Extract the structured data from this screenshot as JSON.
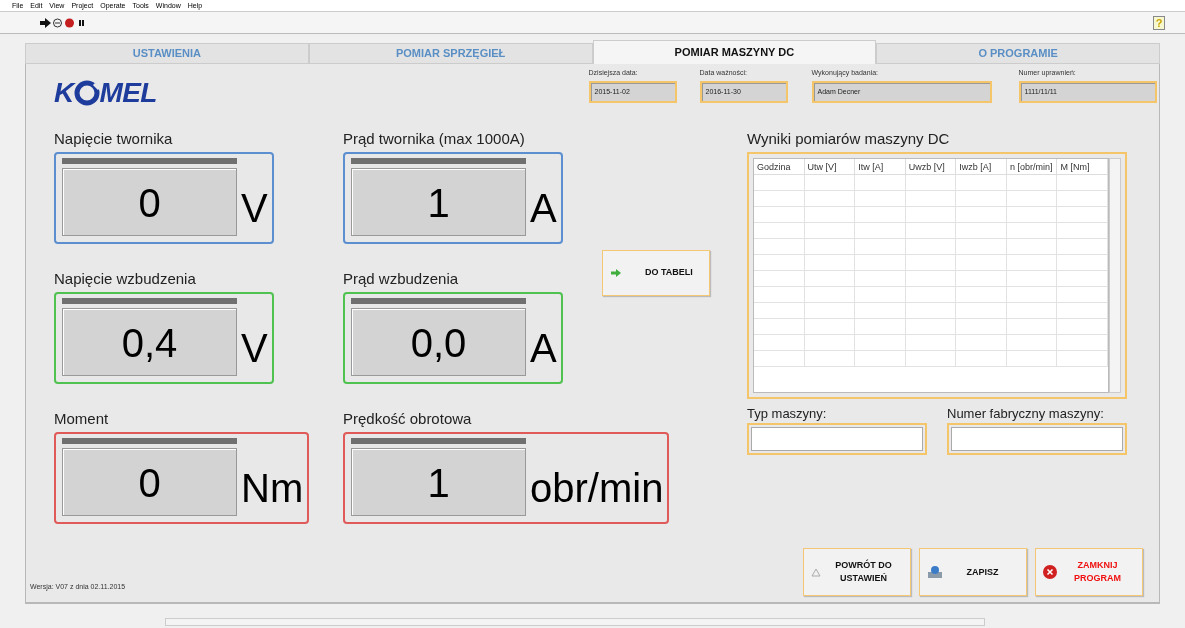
{
  "menu": [
    "File",
    "Edit",
    "View",
    "Project",
    "Operate",
    "Tools",
    "Window",
    "Help"
  ],
  "help_button": "?",
  "tabs": [
    {
      "label": "USTAWIENIA",
      "selected": false
    },
    {
      "label": "POMIAR SPRZĘGIEŁ",
      "selected": false
    },
    {
      "label": "POMIAR MASZYNY DC",
      "selected": true
    },
    {
      "label": "O PROGRAMIE",
      "selected": false
    }
  ],
  "logo": {
    "left": "K",
    "right": "MEL"
  },
  "header_fields": [
    {
      "label": "Dzisiejsza data:",
      "value": "2015-11-02"
    },
    {
      "label": "Data ważności:",
      "value": "2016-11-30"
    },
    {
      "label": "Wykonujący badania:",
      "value": "Adam Decner"
    },
    {
      "label": "Numer uprawnień:",
      "value": "1111/11/11"
    }
  ],
  "meters": [
    {
      "label": "Napięcie twornika",
      "value": "0",
      "unit": "V",
      "color": "#5b8fd0"
    },
    {
      "label": "Prąd twornika (max 1000A)",
      "value": "1",
      "unit": "A",
      "color": "#5b8fd0"
    },
    {
      "label": "Napięcie wzbudzenia",
      "value": "0,4",
      "unit": "V",
      "color": "#4fc24f"
    },
    {
      "label": "Prąd wzbudzenia",
      "value": "0,0",
      "unit": "A",
      "color": "#4fc24f"
    },
    {
      "label": "Moment",
      "value": "0",
      "unit": "Nm",
      "color": "#e05a5a"
    },
    {
      "label": "Prędkość obrotowa",
      "value": "1",
      "unit": "obr/min",
      "color": "#e05a5a"
    }
  ],
  "add_button": "DO TABELI",
  "results": {
    "title": "Wyniki pomiarów maszyny DC",
    "columns": [
      "Godzina",
      "Utw [V]",
      "Itw [A]",
      "Uwzb [V]",
      "Iwzb [A]",
      "n [obr/min]",
      "M [Nm]"
    ]
  },
  "machine_fields": [
    {
      "label": "Typ maszyny:"
    },
    {
      "label": "Numer fabryczny maszyny:"
    }
  ],
  "version": "Wersja: V07 z dnia 02.11.2015",
  "buttons": [
    {
      "kind": "back",
      "label": "POWRÓT DO USTAWIEŃ"
    },
    {
      "kind": "save",
      "label": "ZAPISZ"
    },
    {
      "kind": "close",
      "label": "ZAMKNIJ PROGRAM"
    }
  ]
}
